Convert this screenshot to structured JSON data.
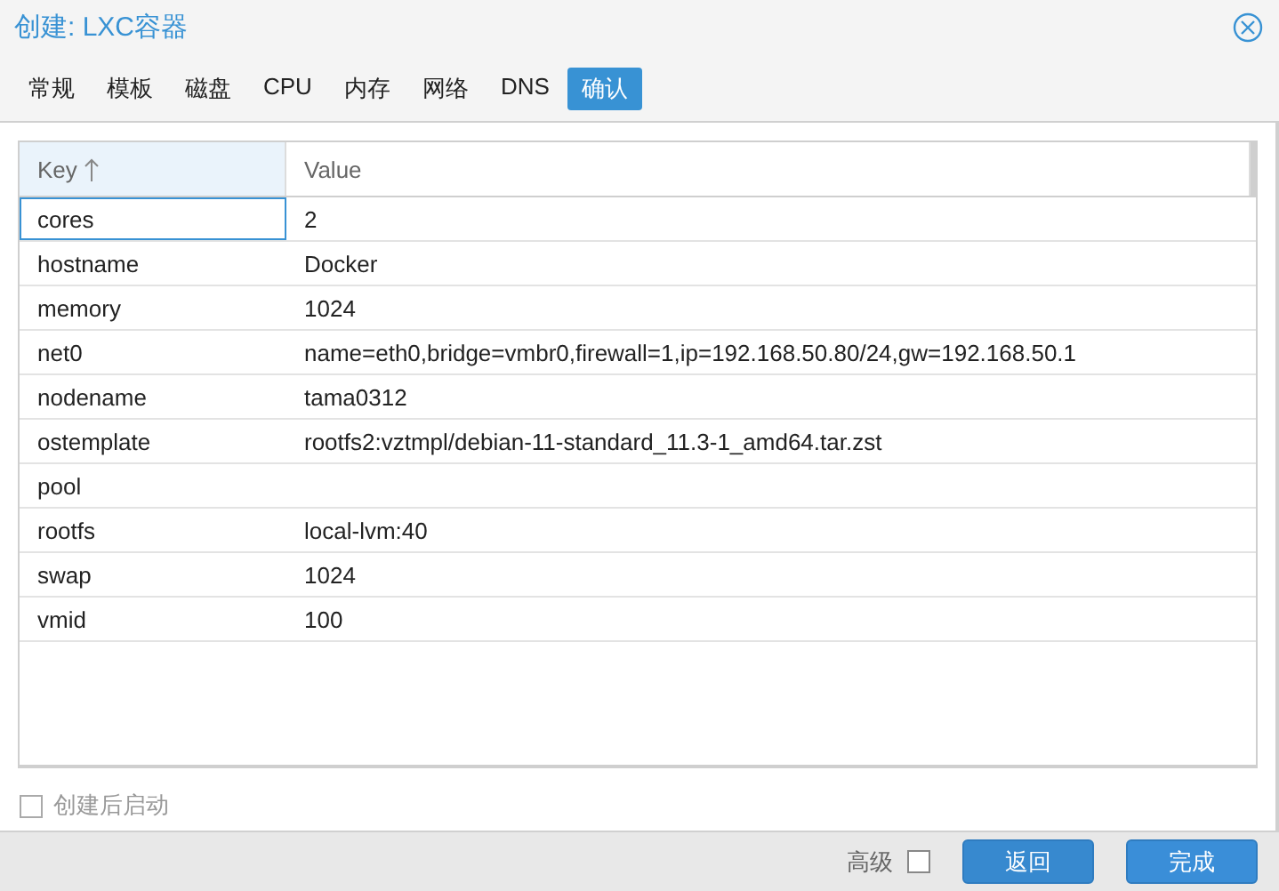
{
  "window": {
    "title": "创建: LXC容器"
  },
  "tabs": [
    {
      "label": "常规",
      "selected": false
    },
    {
      "label": "模板",
      "selected": false
    },
    {
      "label": "磁盘",
      "selected": false
    },
    {
      "label": "CPU",
      "selected": false
    },
    {
      "label": "内存",
      "selected": false
    },
    {
      "label": "网络",
      "selected": false
    },
    {
      "label": "DNS",
      "selected": false
    },
    {
      "label": "确认",
      "selected": true
    }
  ],
  "table": {
    "columns": [
      {
        "label": "Key",
        "sorted": true
      },
      {
        "label": "Value",
        "sorted": false
      }
    ],
    "rows": [
      {
        "key": "cores",
        "value": "2",
        "selected": true
      },
      {
        "key": "hostname",
        "value": "Docker",
        "selected": false
      },
      {
        "key": "memory",
        "value": "1024",
        "selected": false
      },
      {
        "key": "net0",
        "value": "name=eth0,bridge=vmbr0,firewall=1,ip=192.168.50.80/24,gw=192.168.50.1",
        "selected": false
      },
      {
        "key": "nodename",
        "value": "tama0312",
        "selected": false
      },
      {
        "key": "ostemplate",
        "value": "rootfs2:vztmpl/debian-11-standard_11.3-1_amd64.tar.zst",
        "selected": false
      },
      {
        "key": "pool",
        "selected": false
      },
      {
        "key": "rootfs",
        "value": "local-lvm:40",
        "selected": false
      },
      {
        "key": "swap",
        "value": "1024",
        "selected": false
      },
      {
        "key": "vmid",
        "value": "100",
        "selected": false
      }
    ]
  },
  "start_after_create": {
    "label": "创建后启动",
    "checked": false,
    "disabled": true
  },
  "footer": {
    "advanced": {
      "label": "高级",
      "checked": false
    },
    "buttons": [
      "返回",
      "完成"
    ]
  }
}
